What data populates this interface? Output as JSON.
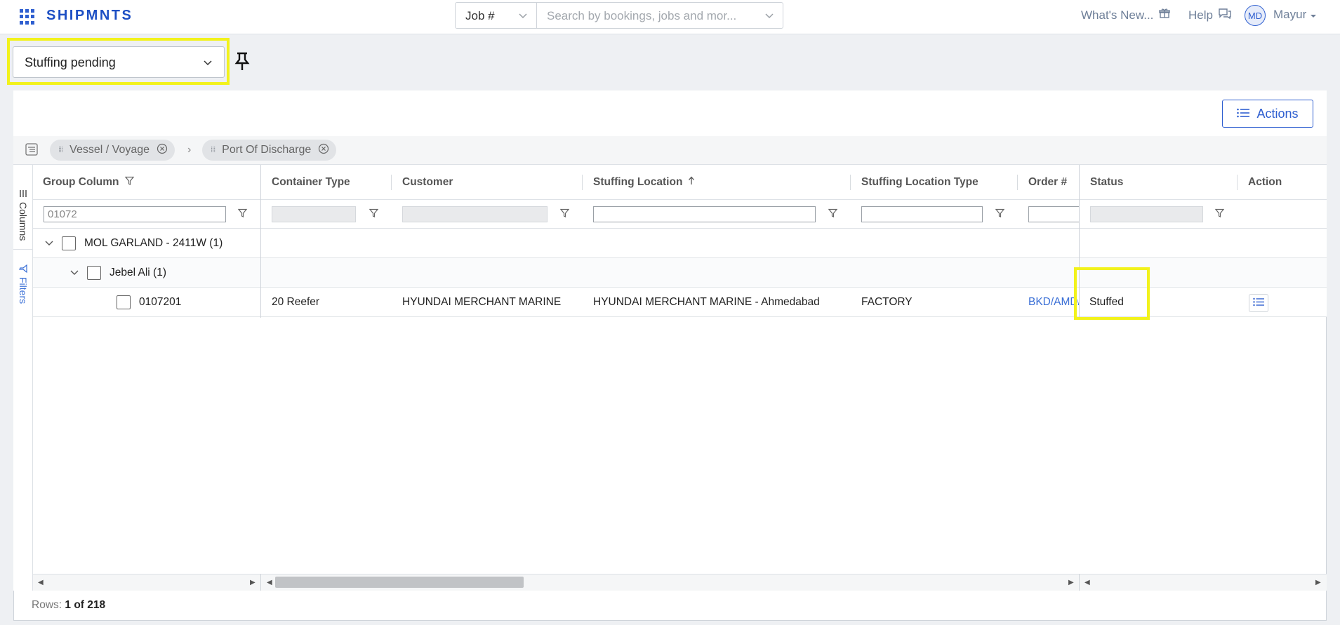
{
  "header": {
    "brand": "SHIPMNTS",
    "job_select": "Job #",
    "search_placeholder": "Search by bookings, jobs and mor...",
    "whats_new": "What's New...",
    "help": "Help",
    "avatar_initials": "MD",
    "user_name": "Mayur"
  },
  "view": {
    "selected": "Stuffing pending"
  },
  "toolbar": {
    "actions_label": "Actions"
  },
  "group_bar": {
    "chips": [
      "Vessel / Voyage",
      "Port Of Discharge"
    ]
  },
  "side_tabs": {
    "columns": "Columns",
    "filters": "Filters"
  },
  "table": {
    "columns": [
      "Group Column",
      "Container Type",
      "Customer",
      "Stuffing Location",
      "Stuffing Location Type",
      "Order #",
      "Status",
      "Action"
    ],
    "group_filter_value": "01072",
    "groups": [
      {
        "label": "MOL GARLAND - 2411W (1)",
        "children": [
          {
            "label": "Jebel Ali (1)",
            "rows": [
              {
                "id": "0107201",
                "container_type": "20 Reefer",
                "customer": "HYUNDAI MERCHANT MARINE",
                "stuffing_location": "HYUNDAI MERCHANT MARINE - Ahmedabad",
                "stuffing_location_type": "FACTORY",
                "order": "BKD/AMD/",
                "status": "Stuffed"
              }
            ]
          }
        ]
      }
    ]
  },
  "footer": {
    "rows_label": "Rows:",
    "rows_value": "1 of 218"
  },
  "colors": {
    "brand": "#1d4fc4",
    "accent": "#2f5fd0",
    "highlight": "#f2f21c",
    "link": "#3a6fd6"
  }
}
